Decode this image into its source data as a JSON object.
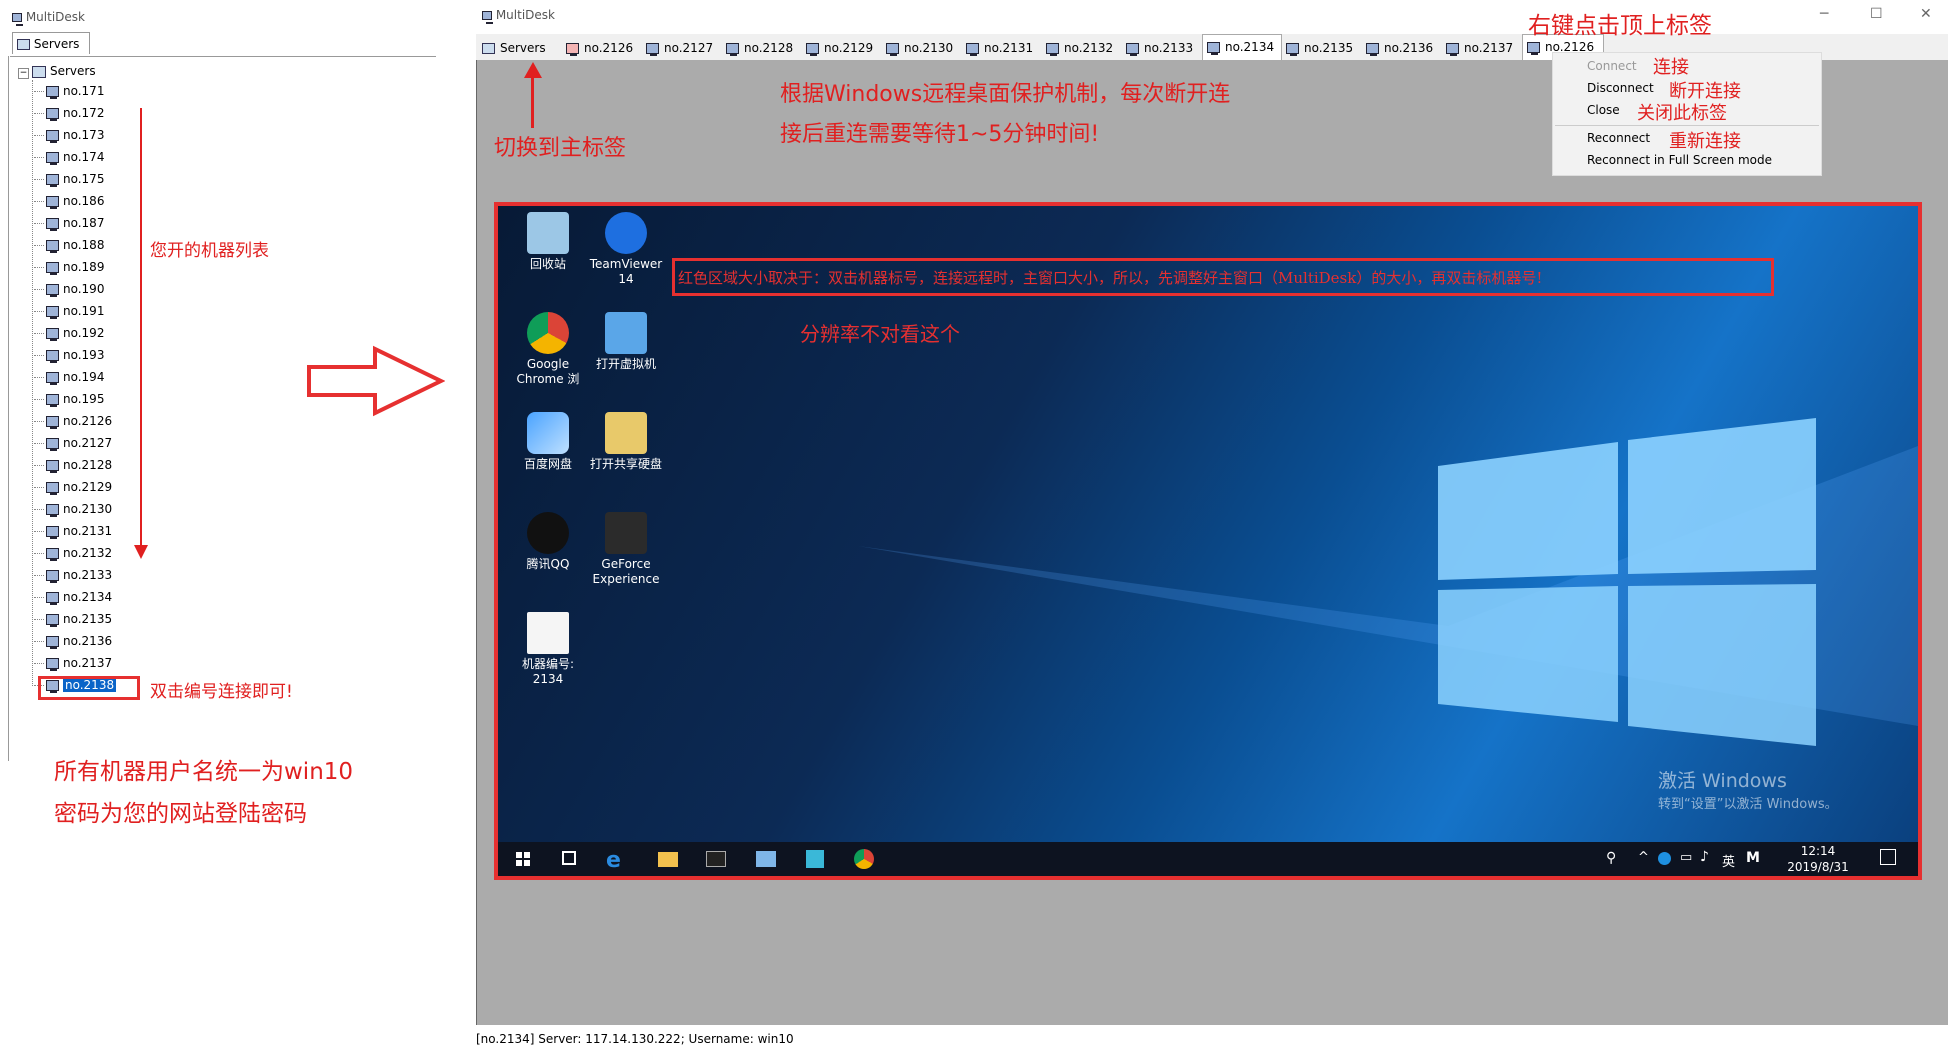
{
  "left_window": {
    "title": "MultiDesk",
    "tab": "Servers",
    "tree_root": "Servers",
    "servers": [
      "no.171",
      "no.172",
      "no.173",
      "no.174",
      "no.175",
      "no.186",
      "no.187",
      "no.188",
      "no.189",
      "no.190",
      "no.191",
      "no.192",
      "no.193",
      "no.194",
      "no.195",
      "no.2126",
      "no.2127",
      "no.2128",
      "no.2129",
      "no.2130",
      "no.2131",
      "no.2132",
      "no.2133",
      "no.2134",
      "no.2135",
      "no.2136",
      "no.2137",
      "no.2138"
    ]
  },
  "main_window": {
    "title": "MultiDesk",
    "tabs": [
      "Servers",
      "no.2126",
      "no.2127",
      "no.2128",
      "no.2129",
      "no.2130",
      "no.2131",
      "no.2132",
      "no.2133",
      "no.2134",
      "no.2135",
      "no.2136",
      "no.2137",
      "no.2126"
    ],
    "active_tab": "no.2134",
    "status": "[no.2134] Server: 117.14.130.222; Username: win10"
  },
  "context_menu": {
    "items": [
      "Connect",
      "Disconnect",
      "Close",
      "Reconnect",
      "Reconnect in Full Screen mode"
    ]
  },
  "remote_desktop": {
    "icons": [
      {
        "name": "回收站",
        "label": "回收站"
      },
      {
        "name": "TeamViewer",
        "label": "TeamViewer\n14"
      },
      {
        "name": "Chrome",
        "label": "Google\nChrome 浏"
      },
      {
        "name": "VM",
        "label": "打开虚拟机"
      },
      {
        "name": "Baidu",
        "label": "百度网盘"
      },
      {
        "name": "Share",
        "label": "打开共享硬盘"
      },
      {
        "name": "QQ",
        "label": "腾讯QQ"
      },
      {
        "name": "GeForce",
        "label": "GeForce\nExperience"
      },
      {
        "name": "Doc",
        "label": "机器编号:\n2134"
      }
    ],
    "watermark_title": "激活 Windows",
    "watermark_sub": "转到“设置”以激活 Windows。",
    "clock_time": "12:14",
    "clock_date": "2019/8/31",
    "ime": "英",
    "ime2": "M"
  },
  "annotations": {
    "top_right": "右键点击顶上标签",
    "ctx_connect": "连接",
    "ctx_disconnect": "断开连接",
    "ctx_close": "关闭此标签",
    "ctx_reconnect": "重新连接",
    "protect_line1": "根据Windows远程桌面保护机制，每次断开连",
    "protect_line2": "接后重连需要等待1~5分钟时间!",
    "switch_main": "切换到主标签",
    "machine_list": "您开的机器列表",
    "double_click": "双击编号连接即可!",
    "account_line1": "所有机器用户名统一为win10",
    "account_line2": "密码为您的网站登陆密码",
    "red_area": "红色区域大小取决于：双击机器标号，连接远程时，主窗口大小，所以，先调整好主窗口（MultiDesk）的大小，再双击标机器号!",
    "resolution": "分辨率不对看这个"
  },
  "colors": {
    "annotation_red": "#e02020",
    "frame_red": "#e63030"
  }
}
